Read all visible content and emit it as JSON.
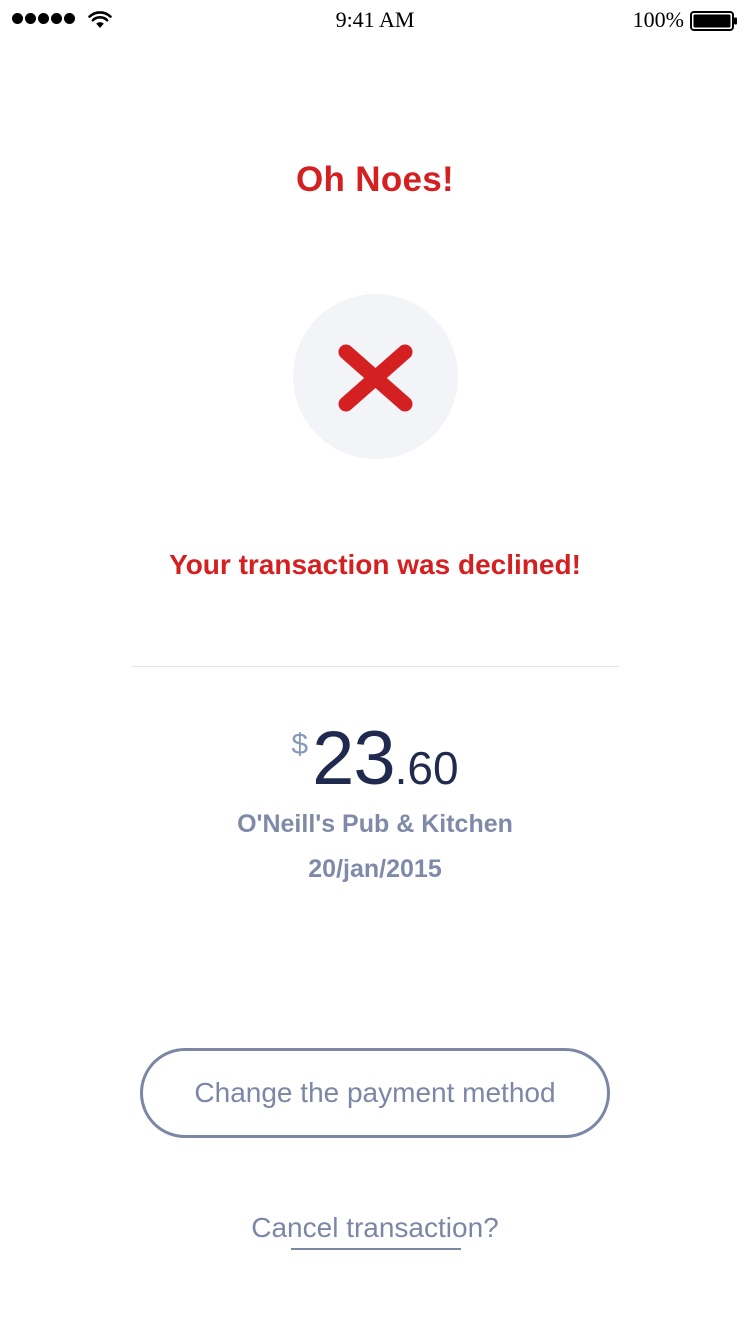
{
  "status_bar": {
    "time": "9:41 AM",
    "battery_percent": "100%",
    "signal_bars": 5,
    "icons": [
      "signal-icon",
      "wifi-icon",
      "battery-icon"
    ]
  },
  "screen": {
    "title": "Oh Noes!",
    "status_icon": "close-icon",
    "message": "Your transaction was declined!"
  },
  "transaction": {
    "currency": "$",
    "amount_whole": "23",
    "amount_cents": ".60",
    "merchant": "O'Neill's Pub & Kitchen",
    "date": "20/jan/2015"
  },
  "actions": {
    "change_payment_label": "Change the payment method",
    "cancel_label": "Cancel transaction?"
  },
  "colors": {
    "error": "#d52022",
    "amount": "#1f2a4e",
    "secondary": "#7c87a6",
    "icon_background": "#f3f4f8",
    "divider": "#e3e5ea"
  }
}
